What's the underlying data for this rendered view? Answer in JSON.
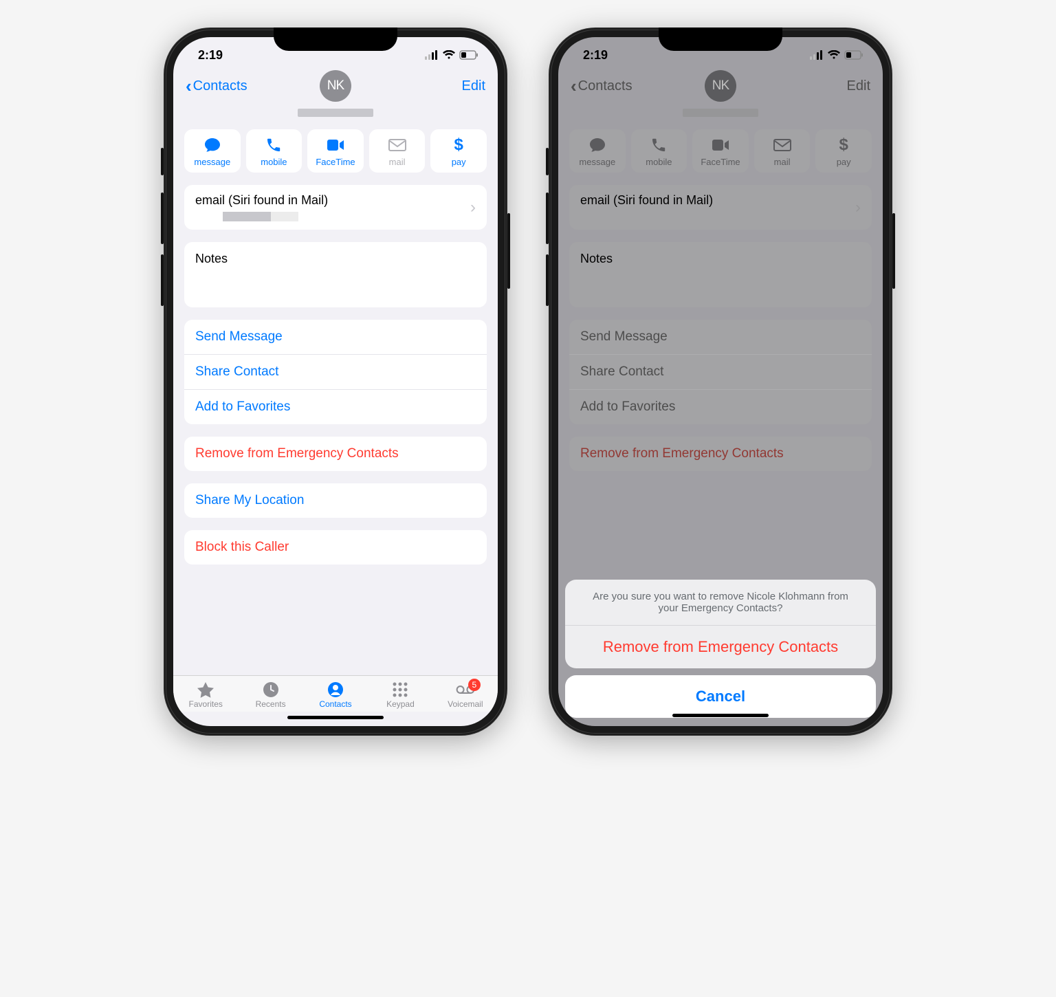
{
  "status": {
    "time": "2:19"
  },
  "nav": {
    "back_label": "Contacts",
    "edit_label": "Edit",
    "avatar_initials": "NK"
  },
  "actions": {
    "message": "message",
    "mobile": "mobile",
    "facetime": "FaceTime",
    "mail": "mail",
    "pay": "pay"
  },
  "email": {
    "label": "email (Siri found in Mail)"
  },
  "notes": {
    "label": "Notes"
  },
  "list": {
    "send_message": "Send Message",
    "share_contact": "Share Contact",
    "add_favorites": "Add to Favorites",
    "remove_emergency": "Remove from Emergency Contacts",
    "share_location": "Share My Location",
    "block": "Block this Caller"
  },
  "tabs": {
    "favorites": "Favorites",
    "recents": "Recents",
    "contacts": "Contacts",
    "keypad": "Keypad",
    "voicemail": "Voicemail",
    "voicemail_badge": "5"
  },
  "sheet": {
    "message": "Are you sure you want to remove Nicole Klohmann from your Emergency Contacts?",
    "destructive": "Remove from Emergency Contacts",
    "cancel": "Cancel"
  }
}
